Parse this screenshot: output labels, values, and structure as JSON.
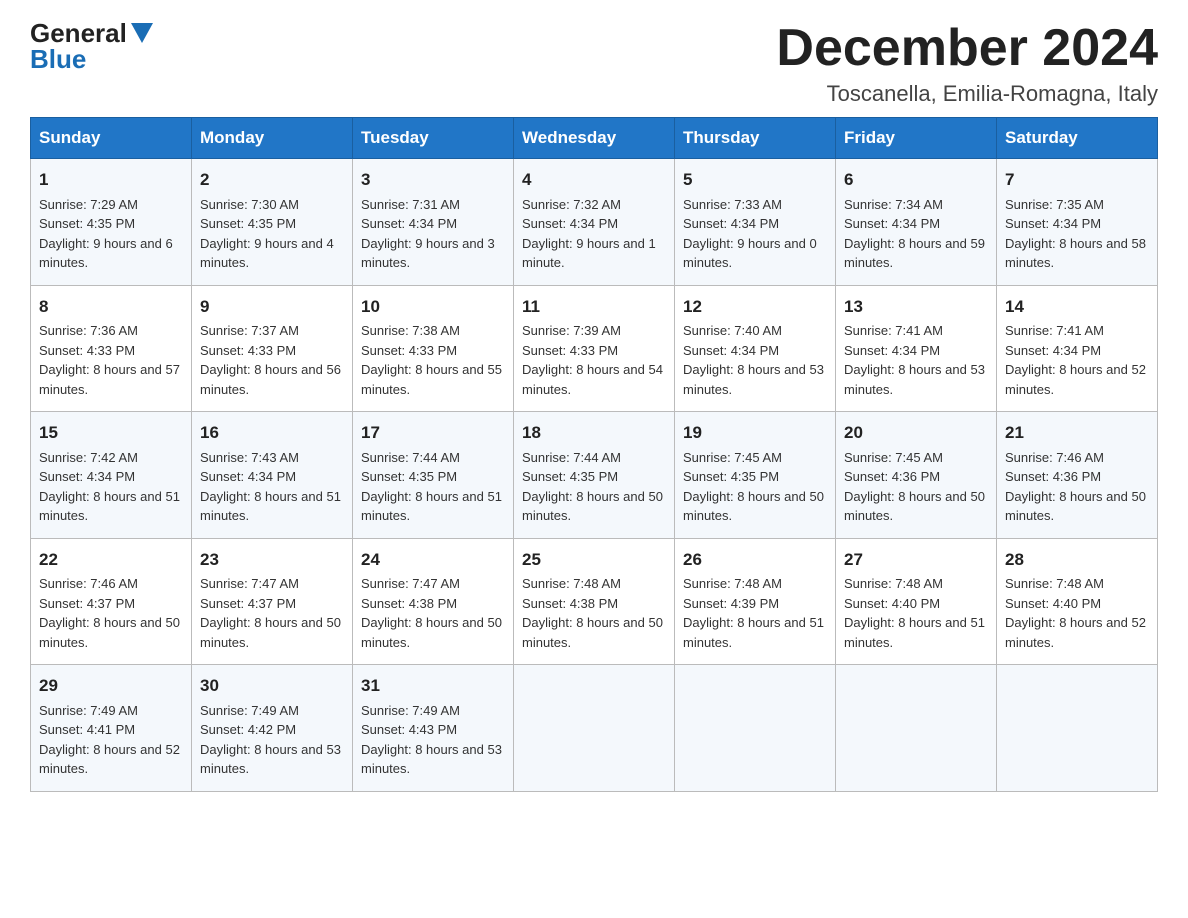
{
  "logo": {
    "general": "General",
    "blue": "Blue"
  },
  "header": {
    "month": "December 2024",
    "location": "Toscanella, Emilia-Romagna, Italy"
  },
  "days_of_week": [
    "Sunday",
    "Monday",
    "Tuesday",
    "Wednesday",
    "Thursday",
    "Friday",
    "Saturday"
  ],
  "weeks": [
    [
      {
        "day": "1",
        "sunrise": "7:29 AM",
        "sunset": "4:35 PM",
        "daylight": "9 hours and 6 minutes."
      },
      {
        "day": "2",
        "sunrise": "7:30 AM",
        "sunset": "4:35 PM",
        "daylight": "9 hours and 4 minutes."
      },
      {
        "day": "3",
        "sunrise": "7:31 AM",
        "sunset": "4:34 PM",
        "daylight": "9 hours and 3 minutes."
      },
      {
        "day": "4",
        "sunrise": "7:32 AM",
        "sunset": "4:34 PM",
        "daylight": "9 hours and 1 minute."
      },
      {
        "day": "5",
        "sunrise": "7:33 AM",
        "sunset": "4:34 PM",
        "daylight": "9 hours and 0 minutes."
      },
      {
        "day": "6",
        "sunrise": "7:34 AM",
        "sunset": "4:34 PM",
        "daylight": "8 hours and 59 minutes."
      },
      {
        "day": "7",
        "sunrise": "7:35 AM",
        "sunset": "4:34 PM",
        "daylight": "8 hours and 58 minutes."
      }
    ],
    [
      {
        "day": "8",
        "sunrise": "7:36 AM",
        "sunset": "4:33 PM",
        "daylight": "8 hours and 57 minutes."
      },
      {
        "day": "9",
        "sunrise": "7:37 AM",
        "sunset": "4:33 PM",
        "daylight": "8 hours and 56 minutes."
      },
      {
        "day": "10",
        "sunrise": "7:38 AM",
        "sunset": "4:33 PM",
        "daylight": "8 hours and 55 minutes."
      },
      {
        "day": "11",
        "sunrise": "7:39 AM",
        "sunset": "4:33 PM",
        "daylight": "8 hours and 54 minutes."
      },
      {
        "day": "12",
        "sunrise": "7:40 AM",
        "sunset": "4:34 PM",
        "daylight": "8 hours and 53 minutes."
      },
      {
        "day": "13",
        "sunrise": "7:41 AM",
        "sunset": "4:34 PM",
        "daylight": "8 hours and 53 minutes."
      },
      {
        "day": "14",
        "sunrise": "7:41 AM",
        "sunset": "4:34 PM",
        "daylight": "8 hours and 52 minutes."
      }
    ],
    [
      {
        "day": "15",
        "sunrise": "7:42 AM",
        "sunset": "4:34 PM",
        "daylight": "8 hours and 51 minutes."
      },
      {
        "day": "16",
        "sunrise": "7:43 AM",
        "sunset": "4:34 PM",
        "daylight": "8 hours and 51 minutes."
      },
      {
        "day": "17",
        "sunrise": "7:44 AM",
        "sunset": "4:35 PM",
        "daylight": "8 hours and 51 minutes."
      },
      {
        "day": "18",
        "sunrise": "7:44 AM",
        "sunset": "4:35 PM",
        "daylight": "8 hours and 50 minutes."
      },
      {
        "day": "19",
        "sunrise": "7:45 AM",
        "sunset": "4:35 PM",
        "daylight": "8 hours and 50 minutes."
      },
      {
        "day": "20",
        "sunrise": "7:45 AM",
        "sunset": "4:36 PM",
        "daylight": "8 hours and 50 minutes."
      },
      {
        "day": "21",
        "sunrise": "7:46 AM",
        "sunset": "4:36 PM",
        "daylight": "8 hours and 50 minutes."
      }
    ],
    [
      {
        "day": "22",
        "sunrise": "7:46 AM",
        "sunset": "4:37 PM",
        "daylight": "8 hours and 50 minutes."
      },
      {
        "day": "23",
        "sunrise": "7:47 AM",
        "sunset": "4:37 PM",
        "daylight": "8 hours and 50 minutes."
      },
      {
        "day": "24",
        "sunrise": "7:47 AM",
        "sunset": "4:38 PM",
        "daylight": "8 hours and 50 minutes."
      },
      {
        "day": "25",
        "sunrise": "7:48 AM",
        "sunset": "4:38 PM",
        "daylight": "8 hours and 50 minutes."
      },
      {
        "day": "26",
        "sunrise": "7:48 AM",
        "sunset": "4:39 PM",
        "daylight": "8 hours and 51 minutes."
      },
      {
        "day": "27",
        "sunrise": "7:48 AM",
        "sunset": "4:40 PM",
        "daylight": "8 hours and 51 minutes."
      },
      {
        "day": "28",
        "sunrise": "7:48 AM",
        "sunset": "4:40 PM",
        "daylight": "8 hours and 52 minutes."
      }
    ],
    [
      {
        "day": "29",
        "sunrise": "7:49 AM",
        "sunset": "4:41 PM",
        "daylight": "8 hours and 52 minutes."
      },
      {
        "day": "30",
        "sunrise": "7:49 AM",
        "sunset": "4:42 PM",
        "daylight": "8 hours and 53 minutes."
      },
      {
        "day": "31",
        "sunrise": "7:49 AM",
        "sunset": "4:43 PM",
        "daylight": "8 hours and 53 minutes."
      },
      {
        "day": "",
        "sunrise": "",
        "sunset": "",
        "daylight": ""
      },
      {
        "day": "",
        "sunrise": "",
        "sunset": "",
        "daylight": ""
      },
      {
        "day": "",
        "sunrise": "",
        "sunset": "",
        "daylight": ""
      },
      {
        "day": "",
        "sunrise": "",
        "sunset": "",
        "daylight": ""
      }
    ]
  ],
  "labels": {
    "sunrise": "Sunrise:",
    "sunset": "Sunset:",
    "daylight": "Daylight:"
  }
}
